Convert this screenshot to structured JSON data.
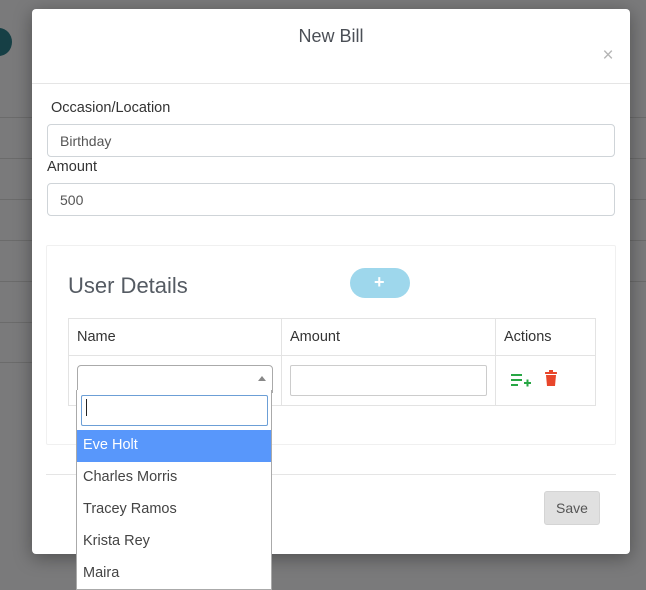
{
  "modal": {
    "title": "New Bill",
    "close_symbol": "×"
  },
  "form": {
    "occasion_label": "Occasion/Location",
    "occasion_value": "Birthday",
    "amount_label": "Amount",
    "amount_value": "500"
  },
  "user_details": {
    "title": "User Details",
    "add_button_symbol": "+",
    "columns": [
      "Name",
      "Amount",
      "Actions"
    ],
    "rows": [
      {
        "name_selected": "",
        "amount_value": ""
      }
    ]
  },
  "dropdown": {
    "search_value": "",
    "options": [
      "Eve Holt",
      "Charles Morris",
      "Tracey Ramos",
      "Krista Rey",
      "Maira"
    ],
    "highlighted_index": 0
  },
  "footer": {
    "save_label": "Save"
  },
  "icons": {
    "add_row": "playlist-add-icon",
    "delete": "trash-icon"
  },
  "colors": {
    "add_button": "#9ed7ec",
    "add_row_icon": "#28a745",
    "delete_icon": "#e8462b",
    "dropdown_highlight": "#5897fb",
    "backdrop_accent": "#2c7f8a"
  }
}
